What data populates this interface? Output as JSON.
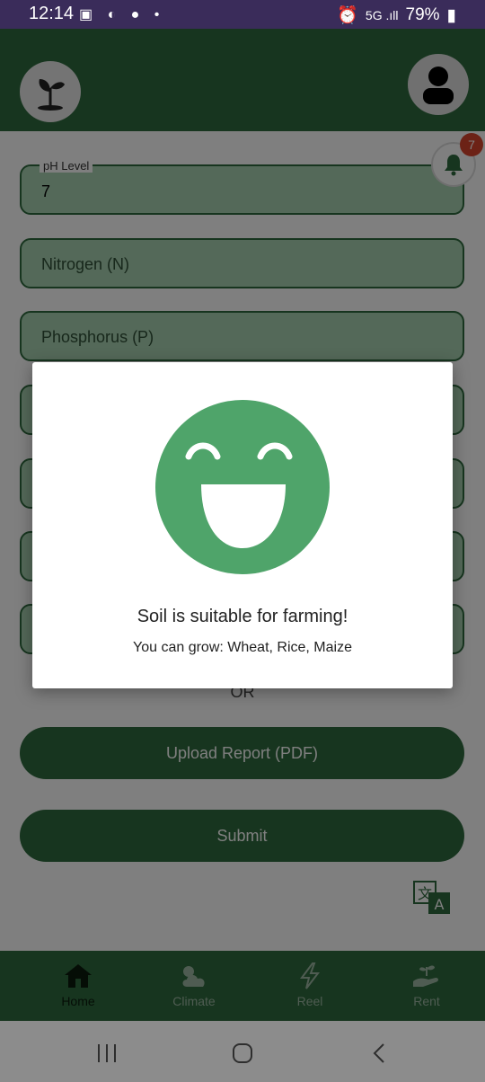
{
  "status_bar": {
    "time": "12:14",
    "battery": "79%"
  },
  "form": {
    "ph_level_label": "pH Level",
    "ph_level_value": "7",
    "nitrogen_placeholder": "Nitrogen (N)",
    "phosphorus_placeholder": "Phosphorus (P)",
    "or_label": "OR",
    "upload_button": "Upload Report (PDF)",
    "submit_button": "Submit"
  },
  "notifications": {
    "count": "7"
  },
  "dialog": {
    "title": "Soil is suitable for farming!",
    "message": "You can grow: Wheat, Rice, Maize"
  },
  "bottom_nav": {
    "items": [
      {
        "label": "Home",
        "icon": "home-icon",
        "active": true
      },
      {
        "label": "Climate",
        "icon": "cloud-sun-icon",
        "active": false
      },
      {
        "label": "Reel",
        "icon": "lightning-icon",
        "active": false
      },
      {
        "label": "Rent",
        "icon": "hand-plant-icon",
        "active": false
      }
    ]
  },
  "colors": {
    "primary": "#2e6b3e",
    "field_fill": "#a9d3b2",
    "smiley": "#4fa46a",
    "badge": "#d9452d"
  }
}
